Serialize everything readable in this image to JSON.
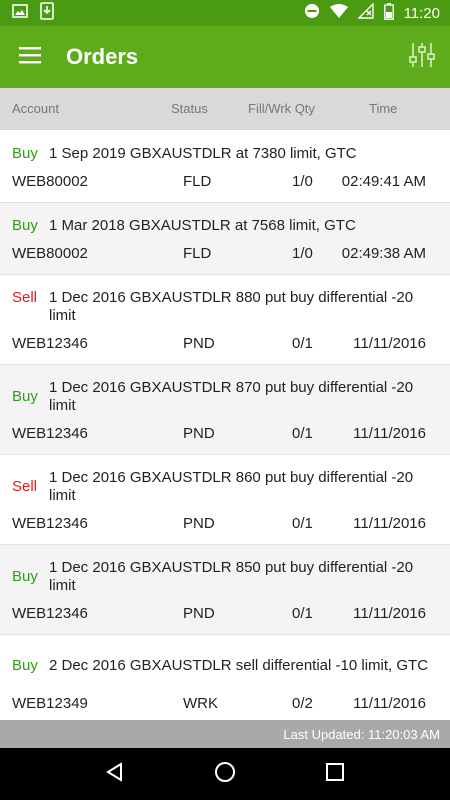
{
  "status_bar": {
    "time": "11:20"
  },
  "app_bar": {
    "title": "Orders"
  },
  "columns": {
    "account": "Account",
    "status": "Status",
    "qty": "Fill/Wrk Qty",
    "time": "Time"
  },
  "orders": [
    {
      "side": "Buy",
      "description": "1 Sep 2019 GBXAUSTDLR at 7380 limit, GTC",
      "account": "WEB80002",
      "status": "FLD",
      "qty": "1/0",
      "time": "02:49:41 AM"
    },
    {
      "side": "Buy",
      "description": "1 Mar 2018 GBXAUSTDLR at 7568 limit, GTC",
      "account": "WEB80002",
      "status": "FLD",
      "qty": "1/0",
      "time": "02:49:38 AM"
    },
    {
      "side": "Sell",
      "description": "1 Dec 2016 GBXAUSTDLR 880 put buy differential -20 limit",
      "account": "WEB12346",
      "status": "PND",
      "qty": "0/1",
      "time": "11/11/2016"
    },
    {
      "side": "Buy",
      "description": "1 Dec 2016 GBXAUSTDLR 870 put buy differential -20 limit",
      "account": "WEB12346",
      "status": "PND",
      "qty": "0/1",
      "time": "11/11/2016"
    },
    {
      "side": "Sell",
      "description": "1 Dec 2016 GBXAUSTDLR 860 put buy differential -20 limit",
      "account": "WEB12346",
      "status": "PND",
      "qty": "0/1",
      "time": "11/11/2016"
    },
    {
      "side": "Buy",
      "description": "1 Dec 2016 GBXAUSTDLR 850 put buy differential -20 limit",
      "account": "WEB12346",
      "status": "PND",
      "qty": "0/1",
      "time": "11/11/2016"
    },
    {
      "side": "Buy",
      "description": "2 Dec 2016 GBXAUSTDLR sell differential -10 limit, GTC",
      "account": "WEB12349",
      "status": "WRK",
      "qty": "0/2",
      "time": "11/11/2016"
    }
  ],
  "footer": {
    "last_updated": "Last Updated: 11:20:03 AM"
  },
  "colors": {
    "app_bar": "#5eac1b",
    "status_bar": "#4a9a12",
    "buy": "#2e9e12",
    "sell": "#e31c1c"
  },
  "icons": {
    "menu": "menu-icon",
    "filter": "sliders-icon",
    "back": "back-icon",
    "home": "home-icon",
    "recents": "recents-icon"
  }
}
